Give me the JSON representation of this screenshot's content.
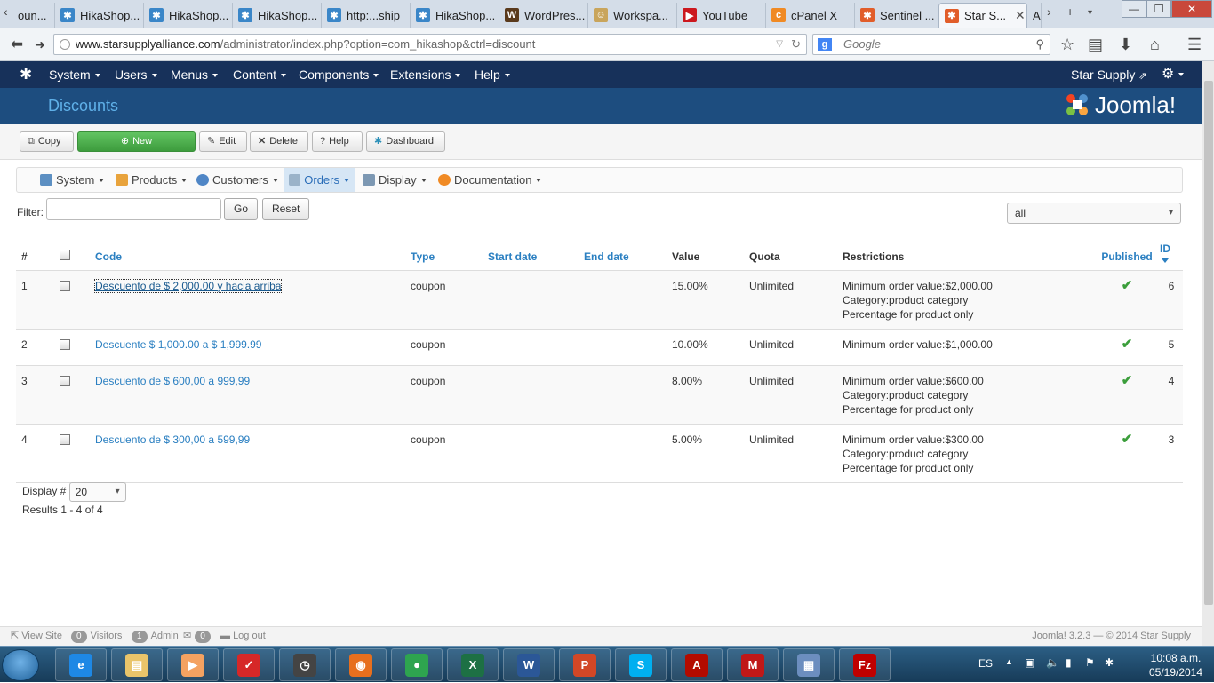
{
  "browser": {
    "tabs": [
      {
        "label": "oun...",
        "icon": "joomla-icon",
        "color": "#e15d2a"
      },
      {
        "label": "HikaShop...",
        "icon": "hikashop-icon",
        "color": "#3a86c8"
      },
      {
        "label": "HikaShop...",
        "icon": "hikashop-icon",
        "color": "#3a86c8"
      },
      {
        "label": "HikaShop...",
        "icon": "hikashop-icon",
        "color": "#3a86c8"
      },
      {
        "label": "http:...ship",
        "icon": "hikashop-icon",
        "color": "#3a86c8"
      },
      {
        "label": "HikaShop...",
        "icon": "hikashop-icon",
        "color": "#3a86c8"
      },
      {
        "label": "WordPres...",
        "icon": "wordpress-icon",
        "color": "#5a3a1c"
      },
      {
        "label": "Workspa...",
        "icon": "workspace-icon",
        "color": "#c9a55c"
      },
      {
        "label": "YouTube",
        "icon": "youtube-icon",
        "color": "#cc181e"
      },
      {
        "label": "cPanel X",
        "icon": "cpanel-icon",
        "color": "#f08a24"
      },
      {
        "label": "Sentinel ...",
        "icon": "joomla-icon",
        "color": "#e15d2a"
      },
      {
        "label": "Star S...",
        "icon": "joomla-icon",
        "color": "#e15d2a",
        "active": true
      }
    ],
    "overflow_tab": "A",
    "url_domain": "www.starsupplyalliance.com",
    "url_path": "/administrator/index.php?option=com_hikashop&ctrl=discount",
    "search_placeholder": "Google"
  },
  "joomla": {
    "menu": [
      "System",
      "Users",
      "Menus",
      "Content",
      "Components",
      "Extensions",
      "Help"
    ],
    "site_name": "Star Supply",
    "page_title": "Discounts",
    "logo_text": "Joomla!"
  },
  "toolbar": {
    "copy": "Copy",
    "new": "New",
    "edit": "Edit",
    "delete": "Delete",
    "help": "Help",
    "dashboard": "Dashboard"
  },
  "hikamenu": [
    "System",
    "Products",
    "Customers",
    "Orders",
    "Display",
    "Documentation"
  ],
  "hikamenu_active": "Orders",
  "filter": {
    "label": "Filter:",
    "value": "",
    "go": "Go",
    "reset": "Reset",
    "state": "all"
  },
  "columns": {
    "num": "#",
    "code": "Code",
    "type": "Type",
    "start": "Start date",
    "end": "End date",
    "value": "Value",
    "quota": "Quota",
    "restrictions": "Restrictions",
    "published": "Published",
    "id": "ID"
  },
  "rows": [
    {
      "num": "1",
      "code": "Descuento de $ 2,000.00 y hacia arriba",
      "type": "coupon",
      "start": "",
      "end": "",
      "value": "15.00%",
      "quota": "Unlimited",
      "r1": "Minimum order value:$2,000.00",
      "r2": "Category:product category",
      "r3": "Percentage for product only",
      "published": true,
      "id": "6"
    },
    {
      "num": "2",
      "code": "Descuente $ 1,000.00 a $ 1,999.99",
      "type": "coupon",
      "start": "",
      "end": "",
      "value": "10.00%",
      "quota": "Unlimited",
      "r1": "Minimum order value:$1,000.00",
      "r2": "",
      "r3": "",
      "published": true,
      "id": "5"
    },
    {
      "num": "3",
      "code": "Descuento de $ 600,00 a 999,99",
      "type": "coupon",
      "start": "",
      "end": "",
      "value": "8.00%",
      "quota": "Unlimited",
      "r1": "Minimum order value:$600.00",
      "r2": "Category:product category",
      "r3": "Percentage for product only",
      "published": true,
      "id": "4"
    },
    {
      "num": "4",
      "code": "Descuento de $ 300,00 a 599,99",
      "type": "coupon",
      "start": "",
      "end": "",
      "value": "5.00%",
      "quota": "Unlimited",
      "r1": "Minimum order value:$300.00",
      "r2": "Category:product category",
      "r3": "Percentage for product only",
      "published": true,
      "id": "3"
    }
  ],
  "pagination": {
    "display_label": "Display #",
    "display_value": "20",
    "results": "Results 1 - 4 of 4"
  },
  "status": {
    "view_site": "View Site",
    "visitors_count": "0",
    "visitors": "Visitors",
    "admin_count": "1",
    "admin": "Admin",
    "messages_count": "0",
    "logout": "Log out",
    "version": "Joomla! 3.2.3",
    "copyright": "— © 2014 Star Supply"
  },
  "taskbar": {
    "apps": [
      {
        "name": "internet-explorer-icon",
        "color": "#1e88e5",
        "glyph": "e"
      },
      {
        "name": "file-explorer-icon",
        "color": "#e9c46a",
        "glyph": "▤"
      },
      {
        "name": "media-player-icon",
        "color": "#f4a261",
        "glyph": "▶"
      },
      {
        "name": "todoist-icon",
        "color": "#d62828",
        "glyph": "✓"
      },
      {
        "name": "clock-app-icon",
        "color": "#444444",
        "glyph": "◷"
      },
      {
        "name": "firefox-icon",
        "color": "#e76f1e",
        "glyph": "◉"
      },
      {
        "name": "chrome-icon",
        "color": "#2ea44f",
        "glyph": "●"
      },
      {
        "name": "excel-icon",
        "color": "#1d7044",
        "glyph": "X"
      },
      {
        "name": "word-icon",
        "color": "#2b5797",
        "glyph": "W"
      },
      {
        "name": "powerpoint-icon",
        "color": "#d24726",
        "glyph": "P"
      },
      {
        "name": "skype-icon",
        "color": "#00aff0",
        "glyph": "S"
      },
      {
        "name": "acrobat-icon",
        "color": "#b30b00",
        "glyph": "A"
      },
      {
        "name": "mcafee-icon",
        "color": "#c01818",
        "glyph": "M"
      },
      {
        "name": "calculator-icon",
        "color": "#6c8ebf",
        "glyph": "▦"
      },
      {
        "name": "filezilla-icon",
        "color": "#bf0000",
        "glyph": "Fz"
      }
    ],
    "lang": "ES",
    "time": "10:08 a.m.",
    "date": "05/19/2014"
  }
}
